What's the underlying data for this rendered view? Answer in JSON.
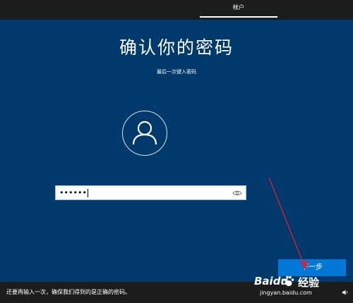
{
  "header": {
    "tab_label": "帐户"
  },
  "main": {
    "title": "确认你的密码",
    "subtitle": "最后一次键入密码",
    "password_value": "••••••",
    "next_button_label": "下一步"
  },
  "footer": {
    "status_text": "还要再输入一次，确保我们得到的是正确的密码。"
  },
  "watermark": {
    "brand": "Baidu",
    "product": "经验",
    "url": "jingyan.baidu.com"
  },
  "icons": {
    "avatar": "user-icon",
    "reveal": "eye-icon",
    "volume": "speaker-icon",
    "arrow": "annotation-arrow"
  },
  "colors": {
    "background": "#00396b",
    "bars": "#1c1c1c",
    "button": "#0078d7",
    "arrow": "#e0202a"
  }
}
